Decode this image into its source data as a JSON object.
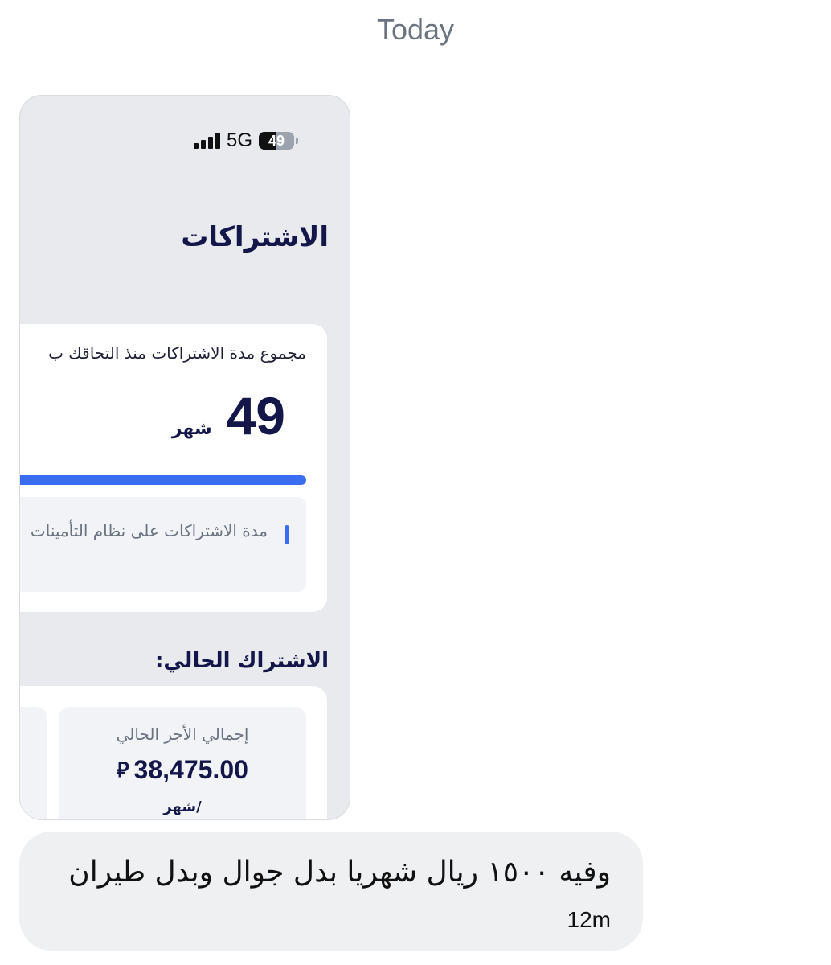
{
  "thread": {
    "day_label": "Today"
  },
  "image_message": {
    "status_bar": {
      "icon": "cellular-signal-icon",
      "network": "5G",
      "battery": "49",
      "battery_level": 0.49
    },
    "page_title": "الاشتراكات",
    "total_card": {
      "caption": "مجموع مدة الاشتراكات منذ التحاقك ب",
      "value": "49",
      "unit": "شهر",
      "progress": 1.0,
      "detail_label": "مدة الاشتراكات على نظام التأمينات"
    },
    "section_title": "الاشتراك الحالي:",
    "current_card": {
      "label": "إجمالي الأجر الحالي",
      "value": "38,475.00",
      "currency_symbol": "⃁",
      "unit": "/شهر"
    }
  },
  "text_message": {
    "text": "وفيه ١٥٠٠ ريال شهريا بدل جوال وبدل طيران",
    "time": "12m"
  },
  "colors": {
    "accent": "#3a6df0",
    "navy": "#14164a",
    "bubble": "#eef0f1",
    "screenshot_bg": "#e9eaee"
  }
}
